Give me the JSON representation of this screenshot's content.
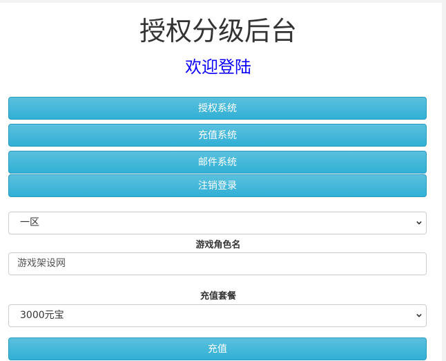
{
  "header": {
    "title": "授权分级后台",
    "subtitle": "欢迎登陆"
  },
  "menu": {
    "auth_system": "授权系统",
    "recharge_system": "充值系统",
    "mail_system": "邮件系统",
    "logout": "注销登录"
  },
  "form": {
    "server_select": {
      "selected": "一区"
    },
    "role_label": "游戏角色名",
    "role_input": {
      "value": "游戏架设网"
    },
    "package_label": "充值套餐",
    "package_select": {
      "selected": "3000元宝"
    },
    "submit_label": "充值"
  }
}
